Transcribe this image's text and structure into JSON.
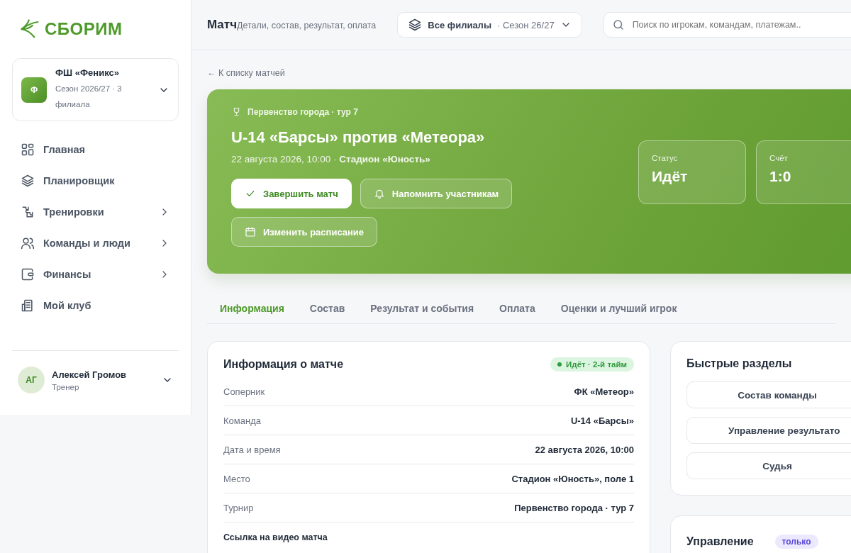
{
  "sidebar": {
    "logo": "СБОРИМ",
    "club": {
      "avatar": "Ф",
      "name": "ФШ «Феникс»",
      "subtitle": "Сезон 2026/27 · 3 филиала"
    },
    "nav": [
      {
        "label": "Главная",
        "has_submenu": false
      },
      {
        "label": "Планировщик",
        "has_submenu": false
      },
      {
        "label": "Тренировки",
        "has_submenu": true
      },
      {
        "label": "Команды и люди",
        "has_submenu": true
      },
      {
        "label": "Финансы",
        "has_submenu": true
      },
      {
        "label": "Мой клуб",
        "has_submenu": false
      }
    ],
    "user": {
      "initials": "АГ",
      "name": "Алексей Громов",
      "role": "Тренер"
    }
  },
  "header": {
    "title": "Матч",
    "subtitle": "Детали, состав, результат, оплата",
    "branch_select": {
      "value": "Все филиалы",
      "season": "· Сезон 26/27"
    },
    "search": {
      "placeholder": "Поиск по игрокам, командам, платежам.."
    }
  },
  "back_link": "← К списку матчей",
  "hero": {
    "tournament": "Первенство города · тур 7",
    "title": "U-14 «Барсы» против «Метеора»",
    "meta": "22 августа 2026, 10:00 · **Стадион «Юность»**",
    "actions": [
      {
        "label": "Завершить матч",
        "kind": "primary"
      },
      {
        "label": "Напомнить участникам",
        "kind": "ghost"
      },
      {
        "label": "Изменить расписание",
        "kind": "ghost"
      }
    ],
    "stats": [
      {
        "label": "Статус",
        "value": "Идёт"
      },
      {
        "label": "Счёт",
        "value": "1:0"
      }
    ]
  },
  "tabs": [
    {
      "label": "Информация",
      "selected": true
    },
    {
      "label": "Состав",
      "selected": false
    },
    {
      "label": "Результат и события",
      "selected": false
    },
    {
      "label": "Оплата",
      "selected": false
    },
    {
      "label": "Оценки и лучший игрок",
      "selected": false
    }
  ],
  "info_card": {
    "title": "Информация о матче",
    "badge": "Идёт · 2-й тайм",
    "rows": [
      {
        "label": "Соперник",
        "value": "ФК «Метеор»"
      },
      {
        "label": "Команда",
        "value": "U-14 «Барсы»"
      },
      {
        "label": "Дата и время",
        "value": "22 августа 2026, 10:00"
      },
      {
        "label": "Место",
        "value": "Стадион «Юность», поле 1"
      },
      {
        "label": "Турнир",
        "value": "Первенство города · тур 7"
      }
    ],
    "video_label": "Ссылка на видео матча"
  },
  "quick_links": {
    "title": "Быстрые разделы",
    "buttons": [
      "Состав команды",
      "Управление результато",
      "Судья"
    ]
  },
  "management": {
    "title": "Управление",
    "badge": "только"
  }
}
